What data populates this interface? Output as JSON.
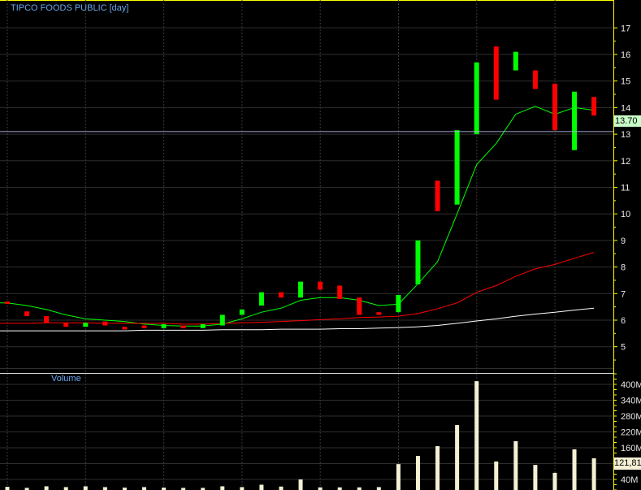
{
  "chart_data": {
    "title": "TIPCO FOODS PUBLIC [day]",
    "type": "candlestick",
    "price_axis": {
      "ticks": [
        5,
        6,
        7,
        8,
        9,
        10,
        11,
        12,
        13,
        14,
        15,
        16,
        17
      ],
      "ylim": [
        4.0,
        17.9
      ],
      "grid": true
    },
    "last_price_label": "13.70",
    "horizontal_line": 13.1,
    "bars": [
      {
        "open": 6.7,
        "close": 6.65
      },
      {
        "open": 6.33,
        "close": 6.15
      },
      {
        "open": 6.15,
        "close": 5.9
      },
      {
        "open": 5.9,
        "close": 5.75
      },
      {
        "open": 5.75,
        "close": 5.9
      },
      {
        "open": 5.95,
        "close": 5.8
      },
      {
        "open": 5.75,
        "close": 5.65
      },
      {
        "open": 5.8,
        "close": 5.7
      },
      {
        "open": 5.7,
        "close": 5.85
      },
      {
        "open": 5.8,
        "close": 5.7
      },
      {
        "open": 5.7,
        "close": 5.85
      },
      {
        "open": 5.8,
        "close": 6.2
      },
      {
        "open": 6.2,
        "close": 6.4
      },
      {
        "open": 6.55,
        "close": 7.05
      },
      {
        "open": 7.05,
        "close": 6.85
      },
      {
        "open": 6.85,
        "close": 7.45
      },
      {
        "open": 7.45,
        "close": 7.15
      },
      {
        "open": 7.3,
        "close": 6.8
      },
      {
        "open": 6.85,
        "close": 6.2
      },
      {
        "open": 6.3,
        "close": 6.2
      },
      {
        "open": 6.3,
        "close": 6.95
      },
      {
        "open": 7.35,
        "close": 9.0
      },
      {
        "open": 11.25,
        "close": 10.1
      },
      {
        "open": 10.35,
        "close": 13.15
      },
      {
        "open": 13.0,
        "close": 15.7
      },
      {
        "open": 16.3,
        "close": 14.3
      },
      {
        "open": 15.4,
        "close": 16.1
      },
      {
        "open": 15.4,
        "close": 14.7
      },
      {
        "open": 14.9,
        "close": 13.15
      },
      {
        "open": 12.4,
        "close": 14.6
      },
      {
        "open": 14.4,
        "close": 13.7
      }
    ],
    "moving_averages": [
      {
        "color": "#00ff00",
        "values": [
          6.65,
          6.55,
          6.4,
          6.2,
          6.05,
          6.0,
          5.95,
          5.85,
          5.8,
          5.78,
          5.78,
          5.85,
          6.05,
          6.3,
          6.45,
          6.75,
          6.85,
          6.85,
          6.75,
          6.55,
          6.6,
          7.37,
          8.2,
          10.0,
          11.85,
          12.65,
          13.75,
          14.05,
          13.75,
          14.0,
          13.9
        ]
      },
      {
        "color": "#ff0000",
        "values": [
          5.88,
          5.88,
          5.9,
          5.9,
          5.9,
          5.88,
          5.88,
          5.88,
          5.88,
          5.85,
          5.85,
          5.88,
          5.9,
          5.92,
          5.95,
          5.98,
          6.02,
          6.05,
          6.1,
          6.12,
          6.15,
          6.25,
          6.43,
          6.65,
          7.05,
          7.3,
          7.65,
          7.93,
          8.1,
          8.33,
          8.55
        ]
      },
      {
        "color": "#ffffff",
        "values": [
          5.6,
          5.6,
          5.6,
          5.6,
          5.6,
          5.6,
          5.6,
          5.62,
          5.62,
          5.62,
          5.62,
          5.64,
          5.64,
          5.64,
          5.66,
          5.66,
          5.66,
          5.68,
          5.68,
          5.7,
          5.72,
          5.75,
          5.8,
          5.88,
          5.97,
          6.05,
          6.15,
          6.23,
          6.3,
          6.38,
          6.45
        ]
      }
    ],
    "volume": {
      "label": "Volume",
      "ticks": [
        "40M",
        "160M",
        "220M",
        "280M",
        "340M",
        "400M"
      ],
      "tick_values": [
        40,
        160,
        220,
        280,
        340,
        400
      ],
      "last_label": "121,81",
      "unit": "M",
      "values": [
        12,
        8,
        14,
        11,
        14,
        11,
        9,
        11,
        9,
        8,
        8,
        14,
        11,
        20,
        13,
        40,
        10,
        10,
        10,
        11,
        98,
        129,
        166,
        246,
        412,
        108,
        185,
        95,
        65,
        154,
        120
      ]
    },
    "colors": {
      "up": "#00ff00",
      "down": "#ff0000",
      "volume": "#f4f0d4",
      "axis": "#ffff00",
      "grid": "#2e2e2e",
      "title": "#6aa8f0"
    }
  }
}
